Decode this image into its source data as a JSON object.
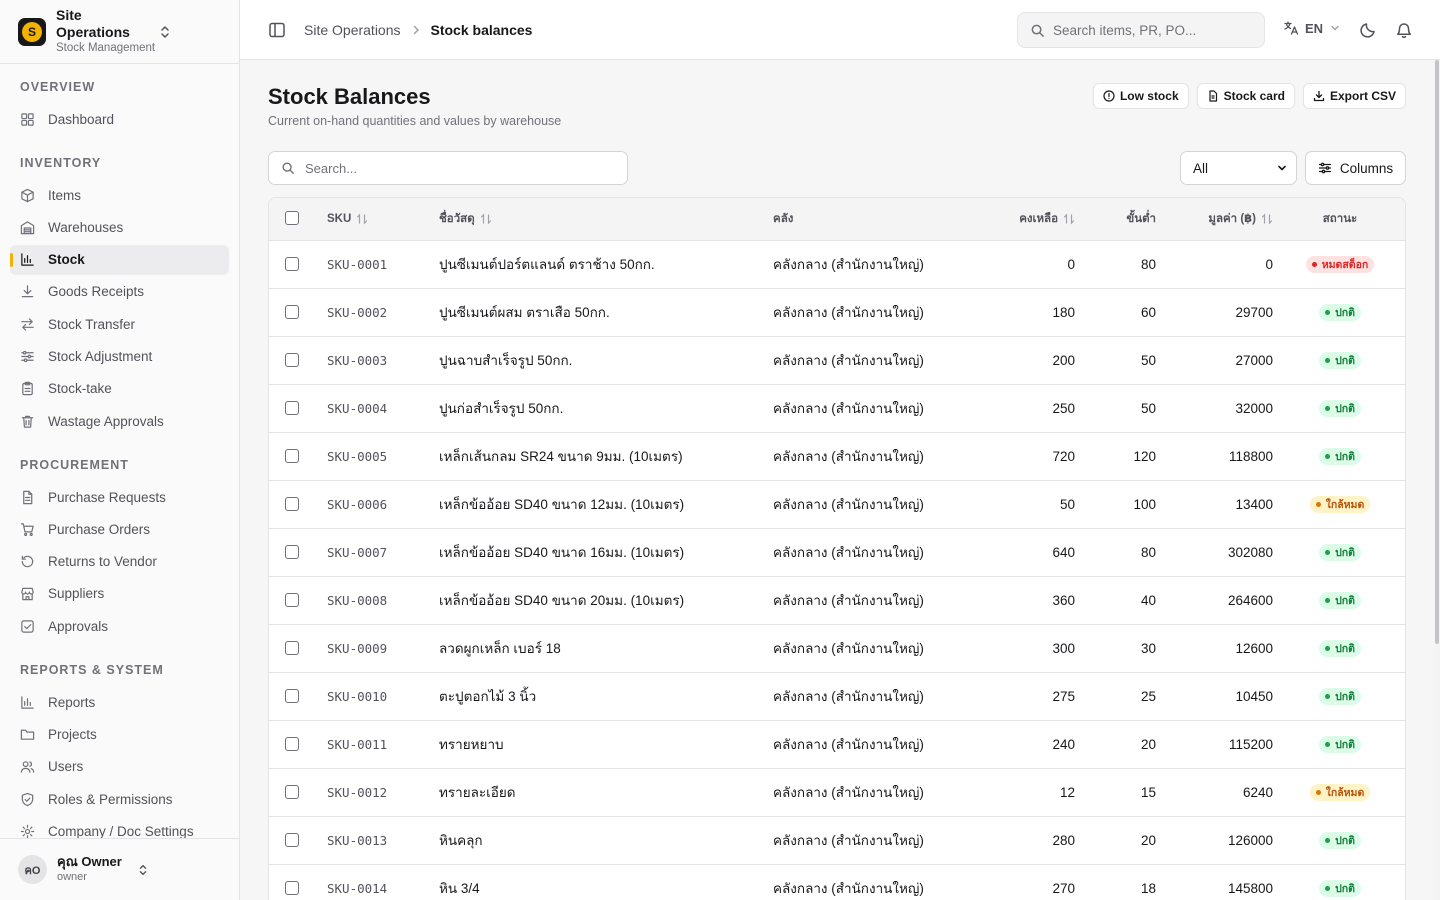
{
  "brand": {
    "logo_letter": "S",
    "title": "Site Operations",
    "subtitle": "Stock Management"
  },
  "sidebar": {
    "sections": [
      {
        "title": "OVERVIEW",
        "items": [
          {
            "label": "Dashboard",
            "icon": "dashboard-icon"
          }
        ]
      },
      {
        "title": "INVENTORY",
        "items": [
          {
            "label": "Items",
            "icon": "box-icon"
          },
          {
            "label": "Warehouses",
            "icon": "warehouse-icon"
          },
          {
            "label": "Stock",
            "icon": "bar-chart-icon",
            "active": true
          },
          {
            "label": "Goods Receipts",
            "icon": "download-icon"
          },
          {
            "label": "Stock Transfer",
            "icon": "transfer-icon"
          },
          {
            "label": "Stock Adjustment",
            "icon": "sliders-icon"
          },
          {
            "label": "Stock-take",
            "icon": "clipboard-icon"
          },
          {
            "label": "Wastage Approvals",
            "icon": "trash-icon"
          }
        ]
      },
      {
        "title": "PROCUREMENT",
        "items": [
          {
            "label": "Purchase Requests",
            "icon": "file-icon"
          },
          {
            "label": "Purchase Orders",
            "icon": "cart-icon"
          },
          {
            "label": "Returns to Vendor",
            "icon": "return-icon"
          },
          {
            "label": "Suppliers",
            "icon": "store-icon"
          },
          {
            "label": "Approvals",
            "icon": "check-square-icon"
          }
        ]
      },
      {
        "title": "REPORTS & SYSTEM",
        "items": [
          {
            "label": "Reports",
            "icon": "bar-chart-icon"
          },
          {
            "label": "Projects",
            "icon": "folder-icon"
          },
          {
            "label": "Users",
            "icon": "users-icon"
          },
          {
            "label": "Roles & Permissions",
            "icon": "shield-icon"
          },
          {
            "label": "Company / Doc Settings",
            "icon": "gear-icon"
          }
        ]
      }
    ]
  },
  "user": {
    "initials": "คO",
    "name": "คุณ Owner",
    "role": "owner"
  },
  "topbar": {
    "breadcrumb_root": "Site Operations",
    "breadcrumb_current": "Stock balances",
    "search_placeholder": "Search items, PR, PO...",
    "language": "EN"
  },
  "page": {
    "title": "Stock Balances",
    "subtitle": "Current on-hand quantities and values by warehouse",
    "actions": {
      "low_stock": "Low stock",
      "stock_card": "Stock card",
      "export_csv": "Export CSV"
    },
    "search_placeholder": "Search...",
    "filter_value": "All",
    "columns_label": "Columns"
  },
  "table": {
    "headers": {
      "sku": "SKU",
      "name": "ชื่อวัสดุ",
      "warehouse": "คลัง",
      "on_hand": "คงเหลือ",
      "minimum": "ขั้นต่ำ",
      "value": "มูลค่า (฿)",
      "status": "สถานะ"
    },
    "rows": [
      {
        "sku": "SKU-0001",
        "name": "ปูนซีเมนต์ปอร์ตแลนด์ ตราช้าง 50กก.",
        "warehouse": "คลังกลาง (สำนักงานใหญ่)",
        "on_hand": "0",
        "minimum": "80",
        "value": "0",
        "status": "หมดสต็อก",
        "status_type": "out"
      },
      {
        "sku": "SKU-0002",
        "name": "ปูนซีเมนต์ผสม ตราเสือ 50กก.",
        "warehouse": "คลังกลาง (สำนักงานใหญ่)",
        "on_hand": "180",
        "minimum": "60",
        "value": "29700",
        "status": "ปกติ",
        "status_type": "ok"
      },
      {
        "sku": "SKU-0003",
        "name": "ปูนฉาบสำเร็จรูป 50กก.",
        "warehouse": "คลังกลาง (สำนักงานใหญ่)",
        "on_hand": "200",
        "minimum": "50",
        "value": "27000",
        "status": "ปกติ",
        "status_type": "ok"
      },
      {
        "sku": "SKU-0004",
        "name": "ปูนก่อสำเร็จรูป 50กก.",
        "warehouse": "คลังกลาง (สำนักงานใหญ่)",
        "on_hand": "250",
        "minimum": "50",
        "value": "32000",
        "status": "ปกติ",
        "status_type": "ok"
      },
      {
        "sku": "SKU-0005",
        "name": "เหล็กเส้นกลม SR24 ขนาด 9มม. (10เมตร)",
        "warehouse": "คลังกลาง (สำนักงานใหญ่)",
        "on_hand": "720",
        "minimum": "120",
        "value": "118800",
        "status": "ปกติ",
        "status_type": "ok"
      },
      {
        "sku": "SKU-0006",
        "name": "เหล็กข้ออ้อย SD40 ขนาด 12มม. (10เมตร)",
        "warehouse": "คลังกลาง (สำนักงานใหญ่)",
        "on_hand": "50",
        "minimum": "100",
        "value": "13400",
        "status": "ใกล้หมด",
        "status_type": "low"
      },
      {
        "sku": "SKU-0007",
        "name": "เหล็กข้ออ้อย SD40 ขนาด 16มม. (10เมตร)",
        "warehouse": "คลังกลาง (สำนักงานใหญ่)",
        "on_hand": "640",
        "minimum": "80",
        "value": "302080",
        "status": "ปกติ",
        "status_type": "ok"
      },
      {
        "sku": "SKU-0008",
        "name": "เหล็กข้ออ้อย SD40 ขนาด 20มม. (10เมตร)",
        "warehouse": "คลังกลาง (สำนักงานใหญ่)",
        "on_hand": "360",
        "minimum": "40",
        "value": "264600",
        "status": "ปกติ",
        "status_type": "ok"
      },
      {
        "sku": "SKU-0009",
        "name": "ลวดผูกเหล็ก เบอร์ 18",
        "warehouse": "คลังกลาง (สำนักงานใหญ่)",
        "on_hand": "300",
        "minimum": "30",
        "value": "12600",
        "status": "ปกติ",
        "status_type": "ok"
      },
      {
        "sku": "SKU-0010",
        "name": "ตะปูตอกไม้ 3 นิ้ว",
        "warehouse": "คลังกลาง (สำนักงานใหญ่)",
        "on_hand": "275",
        "minimum": "25",
        "value": "10450",
        "status": "ปกติ",
        "status_type": "ok"
      },
      {
        "sku": "SKU-0011",
        "name": "ทรายหยาบ",
        "warehouse": "คลังกลาง (สำนักงานใหญ่)",
        "on_hand": "240",
        "minimum": "20",
        "value": "115200",
        "status": "ปกติ",
        "status_type": "ok"
      },
      {
        "sku": "SKU-0012",
        "name": "ทรายละเอียด",
        "warehouse": "คลังกลาง (สำนักงานใหญ่)",
        "on_hand": "12",
        "minimum": "15",
        "value": "6240",
        "status": "ใกล้หมด",
        "status_type": "low"
      },
      {
        "sku": "SKU-0013",
        "name": "หินคลุก",
        "warehouse": "คลังกลาง (สำนักงานใหญ่)",
        "on_hand": "280",
        "minimum": "20",
        "value": "126000",
        "status": "ปกติ",
        "status_type": "ok"
      },
      {
        "sku": "SKU-0014",
        "name": "หิน 3/4",
        "warehouse": "คลังกลาง (สำนักงานใหญ่)",
        "on_hand": "270",
        "minimum": "18",
        "value": "145800",
        "status": "ปกติ",
        "status_type": "ok"
      }
    ]
  },
  "colors": {
    "accent": "#f5b301",
    "status_out": "#dc2626",
    "status_ok": "#16a34a",
    "status_low": "#d97706"
  }
}
